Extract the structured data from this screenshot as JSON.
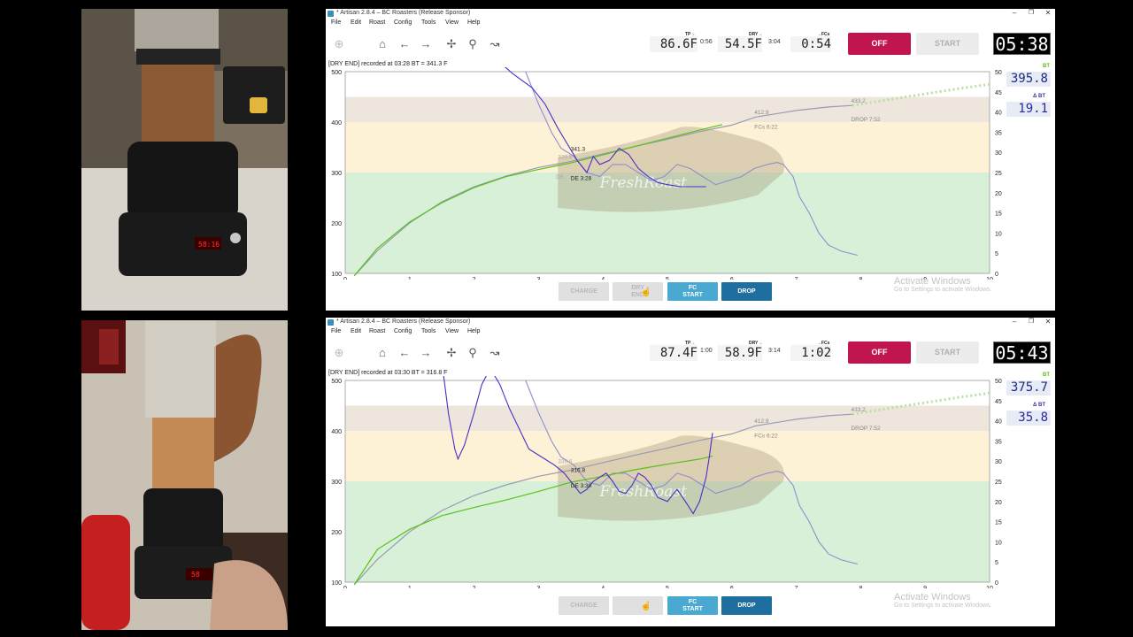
{
  "panels": [
    {
      "id": "top",
      "window_title": "* Artisan 2.8.4 – BC Roasters (Release Sponsor)",
      "menu": [
        "File",
        "Edit",
        "Roast",
        "Config",
        "Tools",
        "View",
        "Help"
      ],
      "lcd": {
        "tp_label": "TP→",
        "tp_value": "86.6F",
        "tp_time": "0:56",
        "dry_label": "DRY→",
        "dry_value": "54.5F",
        "dry_time": "3:04",
        "fcs_label": "→FCs",
        "fcs_value": "0:54"
      },
      "off_label": "OFF",
      "start_label": "START",
      "timer": "05:38",
      "status": "[DRY END] recorded at 03:28 BT = 341.3 F",
      "bt_label": "BT",
      "bt_value": "395.8",
      "dbt_label": "Δ BT",
      "dbt_value": "19.1",
      "event_buttons": {
        "charge": "CHARGE",
        "dry_1": "DRY",
        "dry_2": "END",
        "fc_1": "FC",
        "fc_2": "START",
        "drop": "DROP"
      },
      "annotations": {
        "a1": "341.3",
        "a2": "DE 3:28",
        "a3": "339.6",
        "a4": "DE",
        "a5": "412.9",
        "a6": "FCs 6:22",
        "a7": "433.2",
        "a8": "DROP 7:52"
      }
    },
    {
      "id": "bottom",
      "window_title": "* Artisan 2.8.4 – BC Roasters (Release Sponsor)",
      "menu": [
        "File",
        "Edit",
        "Roast",
        "Config",
        "Tools",
        "View",
        "Help"
      ],
      "lcd": {
        "tp_label": "TP→",
        "tp_value": "87.4F",
        "tp_time": "1:00",
        "dry_label": "DRY→",
        "dry_value": "58.9F",
        "dry_time": "3:14",
        "fcs_label": "→FCs",
        "fcs_value": "1:02"
      },
      "off_label": "OFF",
      "start_label": "START",
      "timer": "05:43",
      "status": "[DRY END] recorded at 03:30 BT = 316.8 F",
      "bt_label": "BT",
      "bt_value": "375.7",
      "dbt_label": "Δ BT",
      "dbt_value": "35.8",
      "event_buttons": {
        "charge": "CHARGE",
        "fc_1": "FC",
        "fc_2": "START",
        "drop": "DROP"
      },
      "annotations": {
        "a1": "316.8",
        "a2": "DE 3:30",
        "a3": "339.6",
        "a5": "412.9",
        "a6": "FCs 6:22",
        "a7": "433.2",
        "a8": "DROP 7:52"
      }
    }
  ],
  "axes": {
    "left_ticks": [
      "100",
      "200",
      "300",
      "400",
      "500"
    ],
    "right_ticks": [
      "0",
      "5",
      "10",
      "15",
      "20",
      "25",
      "30",
      "35",
      "40",
      "45",
      "50"
    ],
    "x_ticks": [
      "0",
      "1",
      "2",
      "3",
      "4",
      "5",
      "6",
      "7",
      "8",
      "9",
      "10"
    ]
  },
  "overlay": {
    "logo_text": "FreshRoast",
    "activate_line1": "Activate Windows",
    "activate_line2": "Go to Settings to activate Windows."
  },
  "photos": {
    "top_display": "58:16",
    "bottom_display": "58"
  },
  "colors": {
    "bt_current": "#59c11a",
    "bt_background": "#9a9ab4",
    "ror_current": "#4a2ec9",
    "ror_background": "#8d8fd0",
    "phase_finish": "#eee6dd",
    "phase_maillard": "#fdf1d6",
    "phase_drying": "#d8f0d8",
    "off_button": "#c1154f",
    "fc_button": "#4aa9d1",
    "drop_button": "#1f6ea0"
  },
  "series": {
    "top": {
      "bt_current": [
        [
          0.14,
          95
        ],
        [
          0.5,
          150
        ],
        [
          1,
          202
        ],
        [
          1.5,
          240
        ],
        [
          2,
          270
        ],
        [
          2.5,
          292
        ],
        [
          3,
          306
        ],
        [
          3.47,
          318
        ],
        [
          4,
          335
        ],
        [
          4.5,
          352
        ],
        [
          5,
          368
        ],
        [
          5.5,
          384
        ],
        [
          5.85,
          395
        ]
      ],
      "bt_background": [
        [
          0.14,
          95
        ],
        [
          0.5,
          145
        ],
        [
          1,
          200
        ],
        [
          1.5,
          242
        ],
        [
          2,
          272
        ],
        [
          2.5,
          293
        ],
        [
          3,
          310
        ],
        [
          3.5,
          322
        ],
        [
          4,
          337
        ],
        [
          4.5,
          352
        ],
        [
          5,
          366
        ],
        [
          5.5,
          381
        ],
        [
          6,
          394
        ],
        [
          6.37,
          410
        ],
        [
          7,
          423
        ],
        [
          7.5,
          430
        ],
        [
          7.87,
          433
        ]
      ],
      "bt_projection": [
        [
          7.87,
          433
        ],
        [
          8.5,
          446
        ],
        [
          9,
          456
        ],
        [
          9.5,
          466
        ],
        [
          10,
          475
        ]
      ],
      "ror_current": [
        [
          2.35,
          53
        ],
        [
          2.6,
          49.5
        ],
        [
          2.9,
          46
        ],
        [
          3.1,
          42
        ],
        [
          3.3,
          36
        ],
        [
          3.45,
          32
        ],
        [
          3.6,
          28
        ],
        [
          3.75,
          25
        ],
        [
          3.85,
          29
        ],
        [
          3.95,
          27
        ],
        [
          4.1,
          28
        ],
        [
          4.25,
          31
        ],
        [
          4.4,
          29.5
        ],
        [
          4.55,
          26
        ],
        [
          4.7,
          24
        ],
        [
          4.85,
          22.5
        ],
        [
          5.0,
          22
        ],
        [
          5.2,
          21.5
        ],
        [
          5.4,
          21.5
        ],
        [
          5.6,
          21.5
        ]
      ],
      "ror_background": [
        [
          2.8,
          50
        ],
        [
          3.0,
          42
        ],
        [
          3.2,
          35
        ],
        [
          3.35,
          31
        ],
        [
          3.55,
          29
        ],
        [
          3.75,
          25
        ],
        [
          3.95,
          24
        ],
        [
          4.15,
          27
        ],
        [
          4.35,
          27
        ],
        [
          4.55,
          25
        ],
        [
          4.75,
          23
        ],
        [
          4.95,
          24
        ],
        [
          5.15,
          27
        ],
        [
          5.35,
          26
        ],
        [
          5.55,
          24
        ],
        [
          5.75,
          22
        ],
        [
          5.95,
          23
        ],
        [
          6.15,
          24
        ],
        [
          6.35,
          26
        ],
        [
          6.55,
          27
        ],
        [
          6.7,
          27.5
        ],
        [
          6.8,
          27
        ],
        [
          6.95,
          24
        ],
        [
          7.05,
          19
        ],
        [
          7.2,
          15
        ],
        [
          7.35,
          10
        ],
        [
          7.5,
          7
        ],
        [
          7.7,
          5.5
        ],
        [
          7.95,
          4.5
        ]
      ]
    },
    "bottom": {
      "bt_current": [
        [
          0.14,
          95
        ],
        [
          0.5,
          165
        ],
        [
          1,
          205
        ],
        [
          1.5,
          232
        ],
        [
          2,
          248
        ],
        [
          2.5,
          263
        ],
        [
          3,
          280
        ],
        [
          3.5,
          298
        ],
        [
          4,
          310
        ],
        [
          4.5,
          323
        ],
        [
          5,
          334
        ],
        [
          5.5,
          344
        ],
        [
          5.7,
          350
        ]
      ],
      "bt_background": [
        [
          0.14,
          95
        ],
        [
          0.5,
          145
        ],
        [
          1,
          200
        ],
        [
          1.5,
          242
        ],
        [
          2,
          272
        ],
        [
          2.5,
          293
        ],
        [
          3,
          310
        ],
        [
          3.5,
          322
        ],
        [
          4,
          337
        ],
        [
          4.5,
          352
        ],
        [
          5,
          366
        ],
        [
          5.5,
          381
        ],
        [
          6,
          394
        ],
        [
          6.37,
          410
        ],
        [
          7,
          423
        ],
        [
          7.5,
          430
        ],
        [
          7.87,
          433
        ]
      ],
      "bt_projection": [
        [
          7.87,
          433
        ],
        [
          8.5,
          446
        ],
        [
          9,
          456
        ],
        [
          9.5,
          466
        ],
        [
          10,
          475
        ]
      ],
      "ror_current": [
        [
          1.52,
          52
        ],
        [
          1.6,
          42
        ],
        [
          1.7,
          33
        ],
        [
          1.75,
          30.5
        ],
        [
          1.85,
          34
        ],
        [
          2.0,
          42
        ],
        [
          2.12,
          49
        ],
        [
          2.25,
          53
        ],
        [
          2.4,
          49
        ],
        [
          2.55,
          43
        ],
        [
          2.7,
          38
        ],
        [
          2.85,
          33
        ],
        [
          3.05,
          31
        ],
        [
          3.25,
          29
        ],
        [
          3.4,
          27
        ],
        [
          3.55,
          24
        ],
        [
          3.65,
          22
        ],
        [
          3.75,
          23
        ],
        [
          3.85,
          25
        ],
        [
          3.95,
          26
        ],
        [
          4.05,
          27
        ],
        [
          4.15,
          25
        ],
        [
          4.25,
          22.5
        ],
        [
          4.35,
          22
        ],
        [
          4.45,
          24
        ],
        [
          4.55,
          27
        ],
        [
          4.65,
          26
        ],
        [
          4.75,
          24
        ],
        [
          4.85,
          21
        ],
        [
          5.0,
          20
        ],
        [
          5.15,
          23
        ],
        [
          5.3,
          19.5
        ],
        [
          5.4,
          17
        ],
        [
          5.5,
          20
        ],
        [
          5.6,
          26
        ],
        [
          5.65,
          31
        ],
        [
          5.7,
          37
        ]
      ],
      "ror_background": [
        [
          2.8,
          50
        ],
        [
          3.0,
          42
        ],
        [
          3.2,
          35
        ],
        [
          3.35,
          31
        ],
        [
          3.55,
          29
        ],
        [
          3.75,
          25
        ],
        [
          3.95,
          24
        ],
        [
          4.15,
          27
        ],
        [
          4.35,
          27
        ],
        [
          4.55,
          25
        ],
        [
          4.75,
          23
        ],
        [
          4.95,
          24
        ],
        [
          5.15,
          27
        ],
        [
          5.35,
          26
        ],
        [
          5.55,
          24
        ],
        [
          5.75,
          22
        ],
        [
          5.95,
          23
        ],
        [
          6.15,
          24
        ],
        [
          6.35,
          26
        ],
        [
          6.55,
          27
        ],
        [
          6.7,
          27.5
        ],
        [
          6.8,
          27
        ],
        [
          6.95,
          24
        ],
        [
          7.05,
          19
        ],
        [
          7.2,
          15
        ],
        [
          7.35,
          10
        ],
        [
          7.5,
          7
        ],
        [
          7.7,
          5.5
        ],
        [
          7.95,
          4.5
        ]
      ]
    }
  }
}
